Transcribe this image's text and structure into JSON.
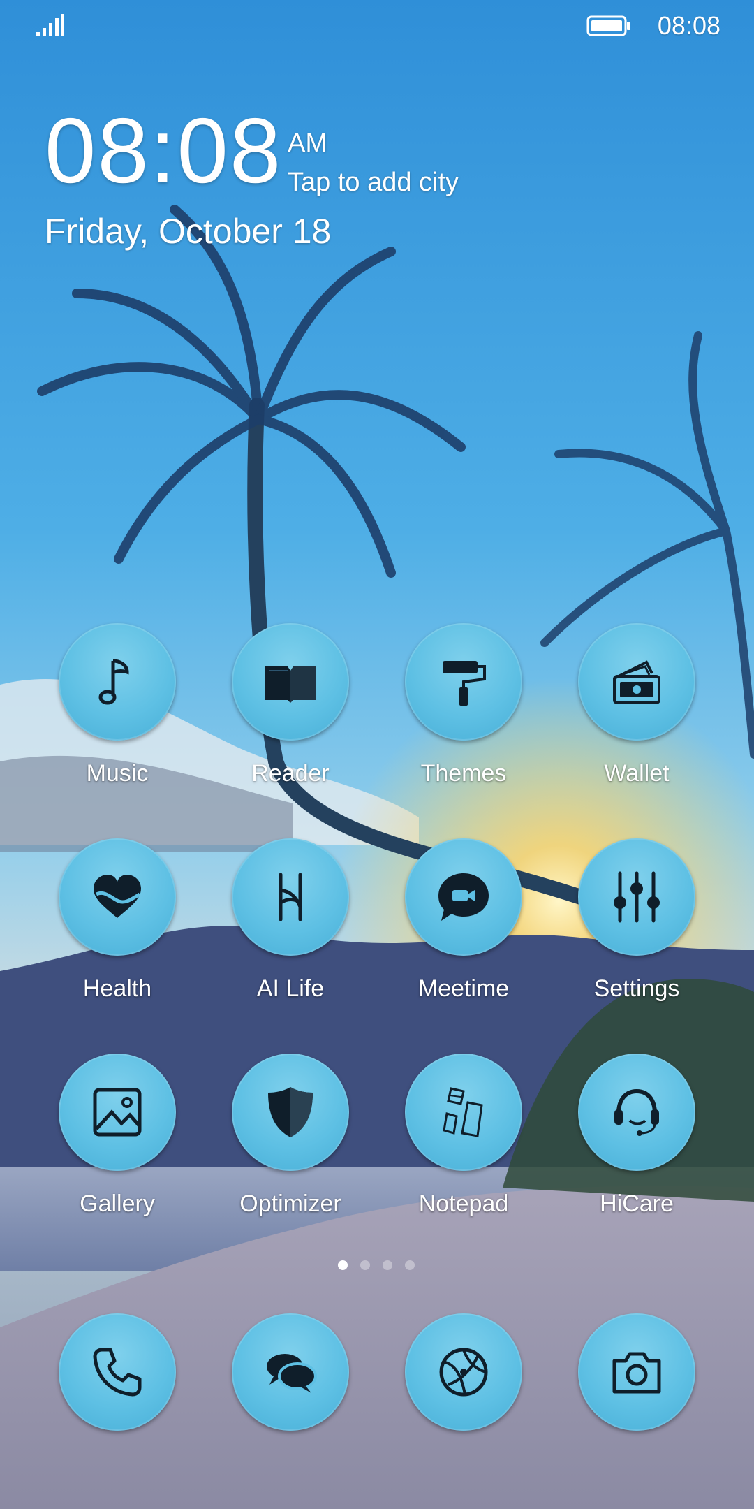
{
  "status_bar": {
    "time": "08:08",
    "signal_icon": "signal-bars-icon",
    "battery_icon": "battery-full-icon"
  },
  "clock_widget": {
    "time": "08:08",
    "ampm": "AM",
    "city_prompt": "Tap to add city",
    "date": "Friday, October 18"
  },
  "apps": [
    {
      "label": "Music",
      "icon": "music-note-icon"
    },
    {
      "label": "Reader",
      "icon": "book-icon"
    },
    {
      "label": "Themes",
      "icon": "paint-roller-icon"
    },
    {
      "label": "Wallet",
      "icon": "wallet-icon"
    },
    {
      "label": "Health",
      "icon": "heart-icon"
    },
    {
      "label": "AI Life",
      "icon": "ai-life-icon"
    },
    {
      "label": "Meetime",
      "icon": "video-chat-icon"
    },
    {
      "label": "Settings",
      "icon": "sliders-icon"
    },
    {
      "label": "Gallery",
      "icon": "picture-icon"
    },
    {
      "label": "Optimizer",
      "icon": "shield-icon"
    },
    {
      "label": "Notepad",
      "icon": "notepad-icon"
    },
    {
      "label": "HiCare",
      "icon": "headset-icon"
    }
  ],
  "dock": [
    {
      "icon": "phone-icon"
    },
    {
      "icon": "messages-icon"
    },
    {
      "icon": "browser-icon"
    },
    {
      "icon": "camera-icon"
    }
  ],
  "page_indicator": {
    "pages": 4,
    "current": 1
  },
  "colors": {
    "icon_bg": "#5ec0e4",
    "glyph": "#0f1e2a",
    "sky_top": "#3a9ee0",
    "sky_bottom": "#9ad6f0"
  }
}
